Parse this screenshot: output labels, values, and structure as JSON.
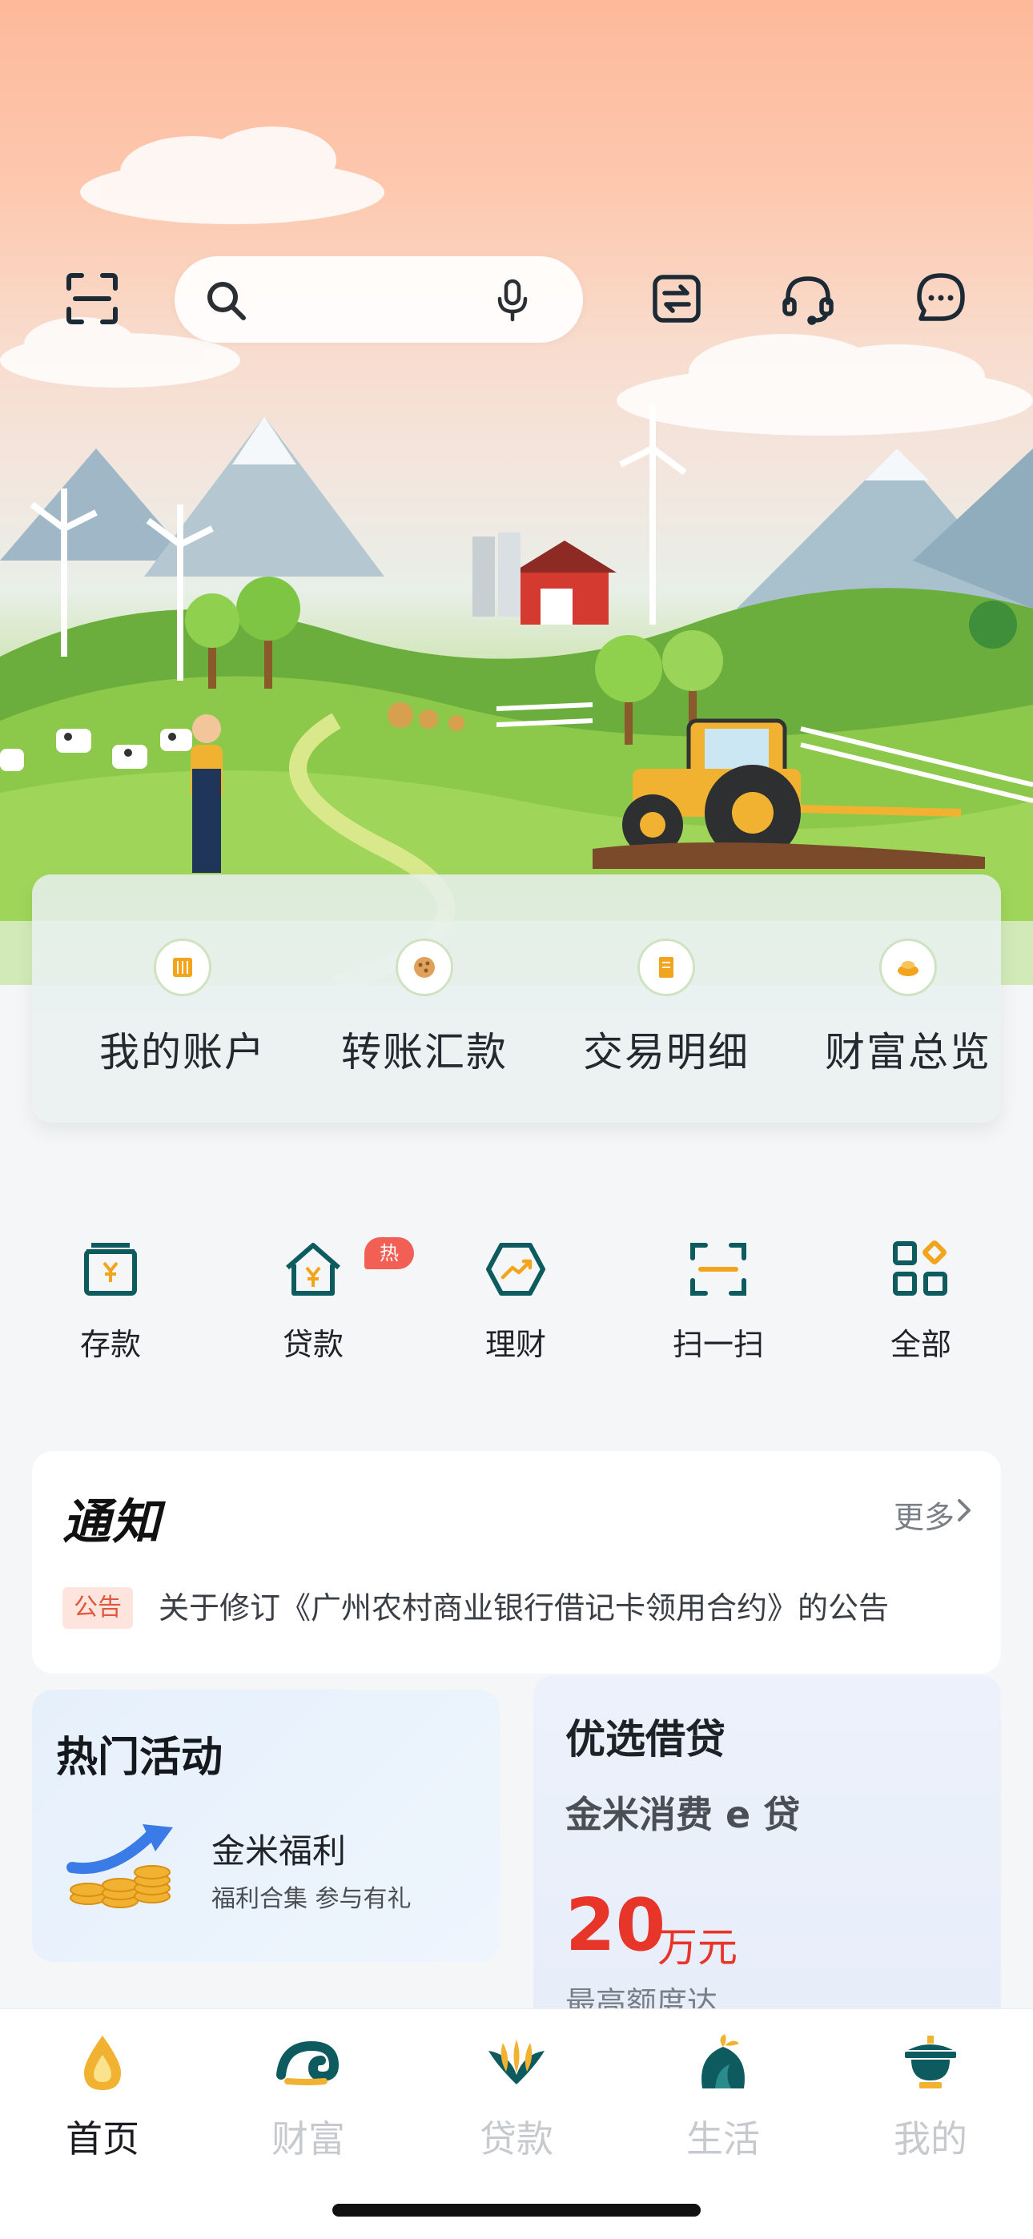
{
  "search": {
    "placeholder": ""
  },
  "topbar": {
    "icons": [
      "scan-icon",
      "search-icon",
      "mic-icon",
      "transfer-icon",
      "headset-icon",
      "message-icon"
    ]
  },
  "quick_actions": [
    {
      "label": "我的账户",
      "icon": "account-icon"
    },
    {
      "label": "转账汇款",
      "icon": "transfer-coin-icon"
    },
    {
      "label": "交易明细",
      "icon": "detail-icon"
    },
    {
      "label": "财富总览",
      "icon": "wealth-icon"
    }
  ],
  "services": [
    {
      "label": "存款",
      "icon": "deposit-icon"
    },
    {
      "label": "贷款",
      "icon": "loan-icon",
      "badge": "热"
    },
    {
      "label": "理财",
      "icon": "finance-icon"
    },
    {
      "label": "扫一扫",
      "icon": "scan-icon"
    },
    {
      "label": "全部",
      "icon": "grid-icon"
    }
  ],
  "notice": {
    "title": "通知",
    "more": "更多",
    "tag": "公告",
    "text": "关于修订《广州农村商业银行借记卡领用合约》的公告"
  },
  "activity": {
    "title": "热门活动",
    "item_title": "金米福利",
    "item_desc": "福利合集  参与有礼"
  },
  "loan_card": {
    "title": "优选借贷",
    "product": "金米消费 e 贷",
    "amount": "20",
    "unit": "万元",
    "limit_label": "最高额度达"
  },
  "tabs": [
    {
      "label": "首页",
      "icon": "home-drop-icon",
      "active": true
    },
    {
      "label": "财富",
      "icon": "wealth-wave-icon",
      "active": false
    },
    {
      "label": "贷款",
      "icon": "loan-leaf-icon",
      "active": false
    },
    {
      "label": "生活",
      "icon": "life-icon",
      "active": false
    },
    {
      "label": "我的",
      "icon": "profile-pot-icon",
      "active": false
    }
  ],
  "colors": {
    "accent": "#f2a51c",
    "brand": "#0d6e6e",
    "alert": "#e8352a"
  }
}
